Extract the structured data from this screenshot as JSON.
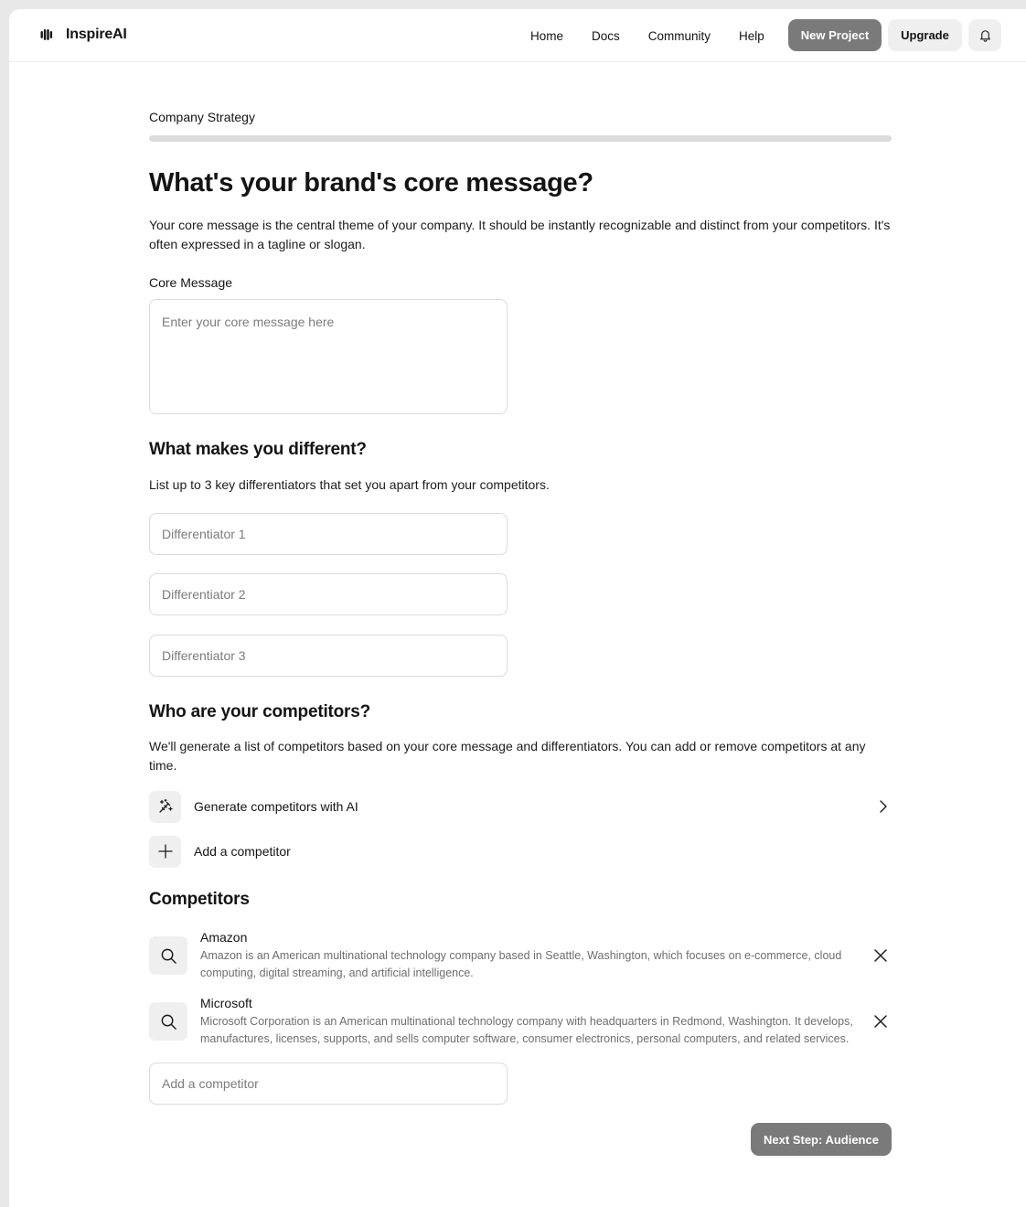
{
  "app": {
    "name": "InspireAI",
    "logo_icon": "waveform-logo-icon"
  },
  "nav": {
    "links": [
      "Home",
      "Docs",
      "Community",
      "Help"
    ],
    "new_project_label": "New Project",
    "upgrade_label": "Upgrade",
    "bell_icon": "bell-icon"
  },
  "step": {
    "label": "Company Strategy"
  },
  "core": {
    "heading": "What's your brand's core message?",
    "description": "Your core message is the central theme of your company. It should be instantly recognizable and distinct from your competitors. It's often expressed in a tagline or slogan.",
    "field_label": "Core Message",
    "value": "",
    "placeholder": "Enter your core message here"
  },
  "different": {
    "heading": "What makes you different?",
    "description": "List up to 3 key differentiators that set you apart from your competitors.",
    "inputs": [
      {
        "value": "",
        "placeholder": "Differentiator 1"
      },
      {
        "value": "",
        "placeholder": "Differentiator 2"
      },
      {
        "value": "",
        "placeholder": "Differentiator 3"
      }
    ]
  },
  "who": {
    "heading": "Who are your competitors?",
    "description": "We'll generate a list of competitors based on your core message and differentiators. You can add or remove competitors at any time.",
    "generate_label": "Generate competitors with AI",
    "generate_icon": "magic-wand-icon",
    "add_label": "Add a competitor",
    "add_icon": "plus-icon"
  },
  "competitors": {
    "heading": "Competitors",
    "items": [
      {
        "name": "Amazon",
        "description": "Amazon is an American multinational technology company based in Seattle, Washington, which focuses on e-commerce, cloud computing, digital streaming, and artificial intelligence."
      },
      {
        "name": "Microsoft",
        "description": "Microsoft Corporation is an American multinational technology company with headquarters in Redmond, Washington. It develops, manufactures, licenses, supports, and sells computer software, consumer electronics, personal computers, and related services."
      }
    ],
    "add_input": {
      "value": "",
      "placeholder": "Add a competitor"
    }
  },
  "footer": {
    "next_label": "Next Step: Audience"
  },
  "colors": {
    "primary_button": "#7a7a7a",
    "secondary_button": "#efefef",
    "progress_track": "#dcdcdc",
    "border": "#dadada"
  }
}
